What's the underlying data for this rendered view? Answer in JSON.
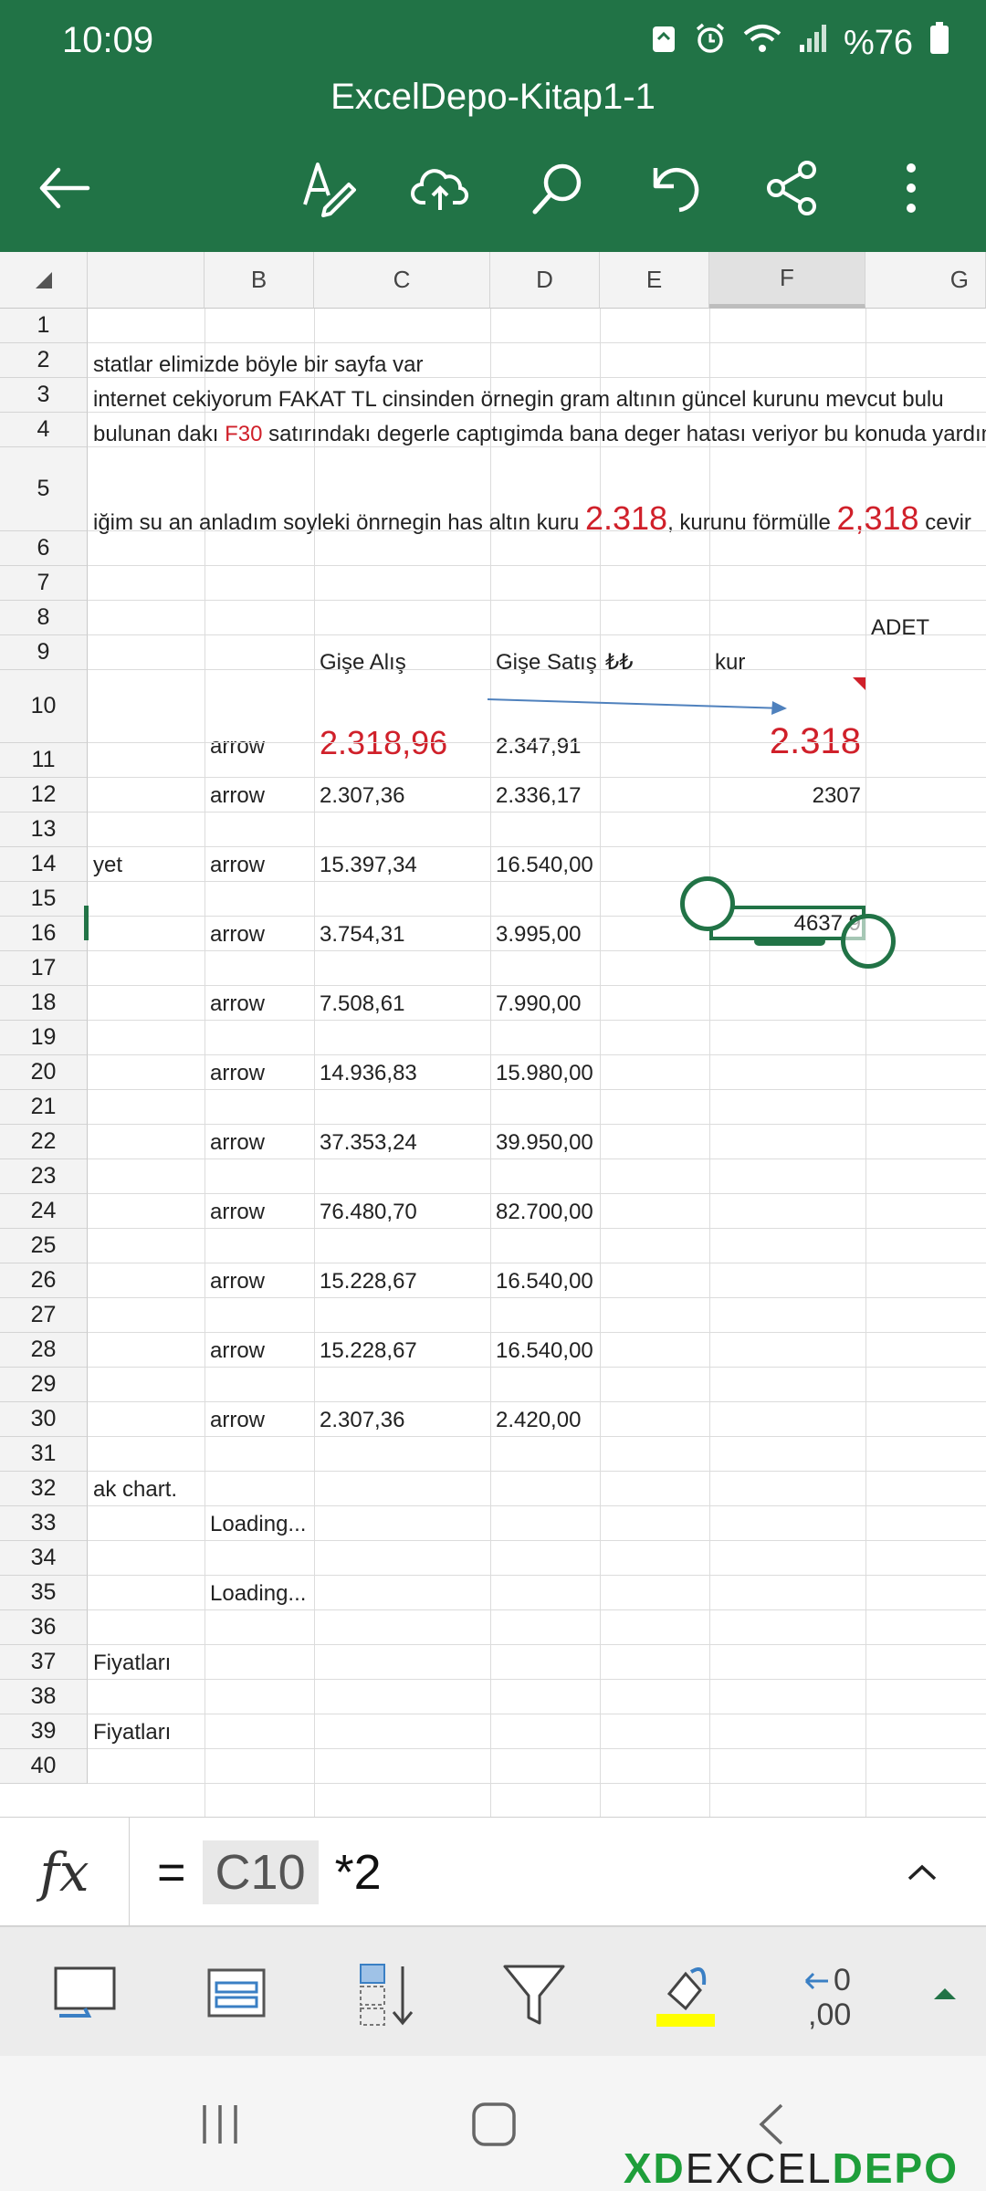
{
  "status": {
    "time": "10:09",
    "battery": "%76",
    "icons": [
      "recycle-icon",
      "alarm-icon",
      "wifi-icon",
      "signal-icon",
      "battery-icon"
    ]
  },
  "header": {
    "title": "ExcelDepo-Kitap1-1",
    "accent": "#217346"
  },
  "toolbar": {
    "icons": [
      "back-arrow-icon",
      "pen-edit-icon",
      "cloud-upload-icon",
      "search-icon",
      "undo-icon",
      "share-icon",
      "more-icon"
    ]
  },
  "columns": [
    "",
    "B",
    "C",
    "D",
    "E",
    "F",
    "G"
  ],
  "selected_column": "F",
  "rows": [
    "1",
    "2",
    "3",
    "4",
    "5",
    "6",
    "7",
    "8",
    "9",
    "10",
    "11",
    "12",
    "13",
    "14",
    "15",
    "16",
    "17",
    "18",
    "19",
    "20",
    "21",
    "22",
    "23",
    "24",
    "25",
    "26",
    "27",
    "28",
    "29",
    "30",
    "31",
    "32",
    "33",
    "34",
    "35",
    "36",
    "37",
    "38",
    "39",
    "40"
  ],
  "cells": {
    "r2": "statlar elimizde böyle bir sayfa var",
    "r3": "internet cekiyorum  FAKAT  TL cinsinden  örnegin  gram altının  güncel kurunu mevcut bulu",
    "r4a": "bulunan dakı ",
    "r4ref": "F30",
    "r4b": " satırındakı degerle captıgimda bana deger hatası veriyor bu konuda  yardım",
    "r5a": "iğim  su an  anladım soyleki  önrnegin has altın kuru ",
    "r5v1": "2.318",
    "r5b": ", kurunu förmülle ",
    "r5v2": "2,318",
    "r5c": " cevir",
    "g8": "ADET",
    "c9": "Gişe Alış",
    "d9": "Gişe Satış",
    "e9": "₺₺",
    "f9": "kur",
    "b10": "arrow",
    "c10": "2.318,96",
    "d10": "2.347,91",
    "f10": "2.318",
    "b12": "arrow",
    "c12": "2.307,36",
    "d12": "2.336,17",
    "f12": "2307",
    "a14": "yet",
    "b14": "arrow",
    "c14": "15.397,34",
    "d14": "16.540,00",
    "f15": "4637,9",
    "b16": "arrow",
    "c16": "3.754,31",
    "d16": "3.995,00",
    "b18": "arrow",
    "c18": "7.508,61",
    "d18": "7.990,00",
    "b20": "arrow",
    "c20": "14.936,83",
    "d20": "15.980,00",
    "b22": "arrow",
    "c22": "37.353,24",
    "d22": "39.950,00",
    "b24": "arrow",
    "c24": "76.480,70",
    "d24": "82.700,00",
    "b26": "arrow",
    "c26": "15.228,67",
    "d26": "16.540,00",
    "b28": "arrow",
    "c28": "15.228,67",
    "d28": "16.540,00",
    "b30": "arrow",
    "c30": "2.307,36",
    "d30": "2.420,00",
    "a32": "ak chart.",
    "b33": "Loading...",
    "b35": "Loading...",
    "a37": "Fiyatları",
    "a39": "Fiyatları"
  },
  "formula": {
    "fx": "fx",
    "eq": "=",
    "ref": "C10",
    "rest": "*2"
  },
  "bottom_tools": [
    "display-icon",
    "freeze-panes-icon",
    "sort-icon",
    "filter-icon",
    "fill-color-icon",
    "decimal-icon",
    "expand-up-icon"
  ],
  "fill_color": "#ffff00",
  "nav": [
    "recent-apps-icon",
    "home-icon",
    "back-icon"
  ],
  "watermark": {
    "a": "XD",
    "b": "EXCEL",
    "c": "DEPO"
  }
}
